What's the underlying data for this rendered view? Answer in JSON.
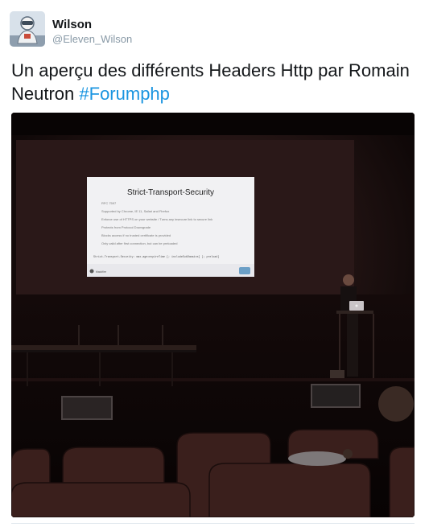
{
  "author": {
    "name": "Wilson",
    "handle": "@Eleven_Wilson"
  },
  "tweet": {
    "text": "Un aperçu des différents Headers Http par Romain Neutron ",
    "hashtag": "#Forumphp"
  },
  "photo": {
    "slide": {
      "title": "Strict-Transport-Security",
      "bullets": [
        "RFC 7597",
        "Supported by Chrome, IE 11, Safari and Firefox",
        "Enforce use of HTTPS on your website / Turns any insecure link to secure link",
        "Protects from Protocol Downgrade",
        "Blocks access if no trusted certificate is provided",
        "Only valid after first connection, but can be preloaded"
      ],
      "code": "Strict-Transport-Security: max-age=expireTime [; includeSubDomains] [; preload]",
      "footer_logo": "blackfire"
    }
  },
  "colors": {
    "hashtag": "#1b95e0",
    "handle": "#8899a6",
    "text": "#14171a"
  }
}
